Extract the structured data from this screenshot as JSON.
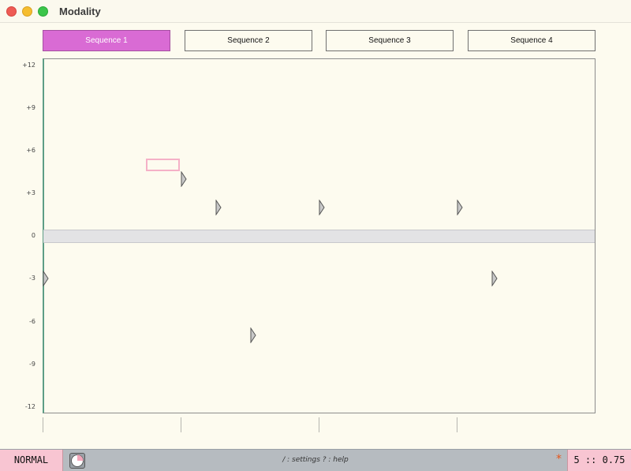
{
  "window": {
    "title": "Modality"
  },
  "tabs": [
    {
      "label": "Sequence 1",
      "active": true
    },
    {
      "label": "Sequence 2",
      "active": false
    },
    {
      "label": "Sequence 3",
      "active": false
    },
    {
      "label": "Sequence 4",
      "active": false
    }
  ],
  "grid": {
    "y_labels": [
      "+12",
      "+9",
      "+6",
      "+3",
      "0",
      "-3",
      "-6",
      "-9",
      "-12"
    ],
    "notes": [
      {
        "step": 0,
        "pitch": -3
      },
      {
        "step": 4,
        "pitch": 4
      },
      {
        "step": 5,
        "pitch": 2
      },
      {
        "step": 6,
        "pitch": -7
      },
      {
        "step": 8,
        "pitch": 2
      },
      {
        "step": 12,
        "pitch": 2
      },
      {
        "step": 13,
        "pitch": -3
      }
    ],
    "cursor": {
      "step": 3,
      "pitch": 5
    }
  },
  "status": {
    "mode": "NORMAL",
    "hint": "/ : settings   ? : help",
    "dirty_marker": "*",
    "position": "5 :: 0.75"
  },
  "colors": {
    "accent": "#d96bd4",
    "mode_bg": "#f8c5d2",
    "cursor": "#f5b1c7",
    "zero_band": "#e3e3e5"
  }
}
